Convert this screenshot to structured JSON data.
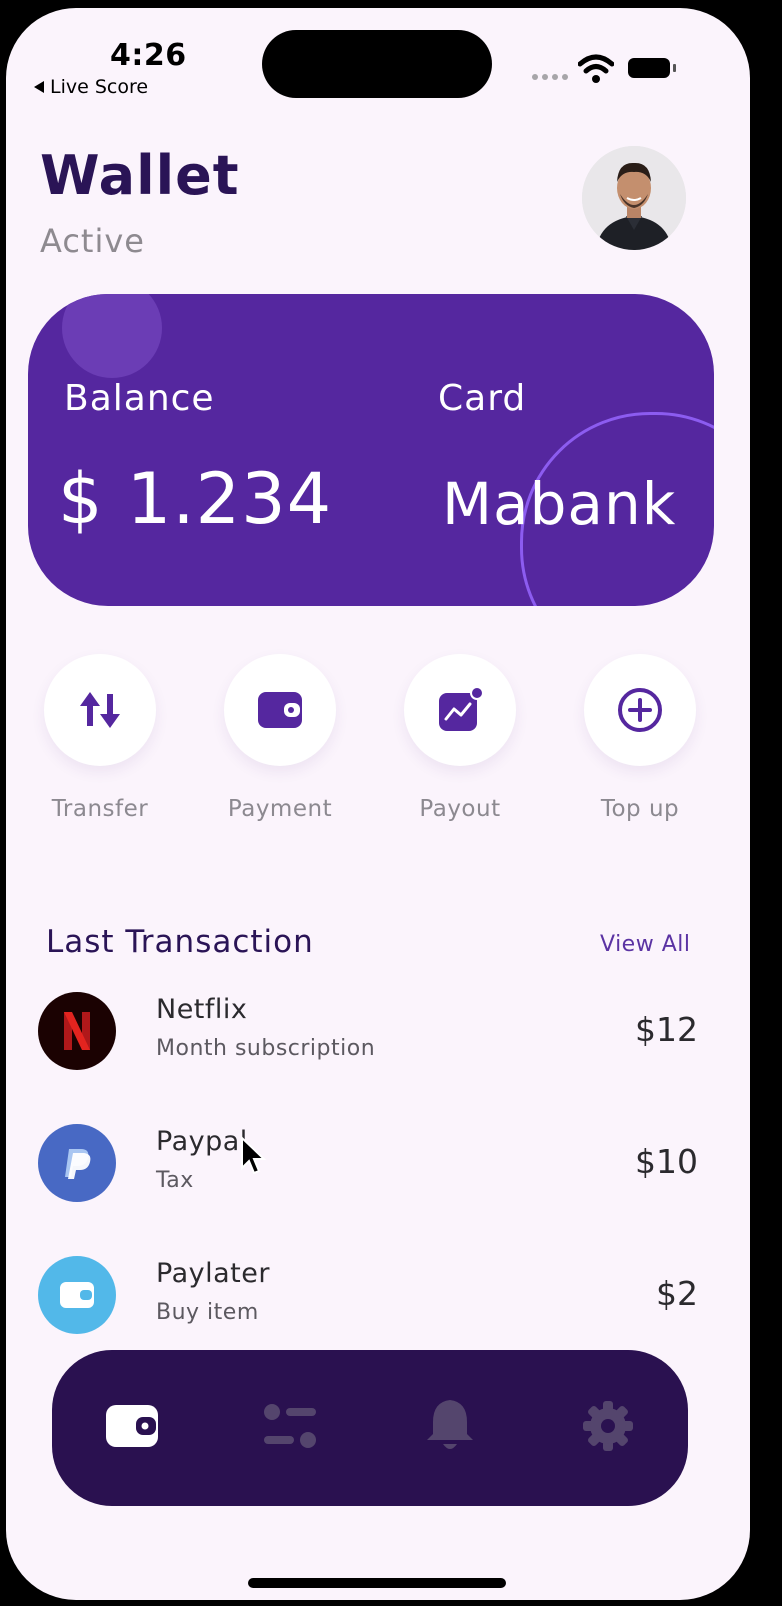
{
  "status_bar": {
    "time": "4:26",
    "back_label": "Live Score"
  },
  "header": {
    "title": "Wallet",
    "subtitle": "Active"
  },
  "card": {
    "balance_label": "Balance",
    "balance_value": "$ 1.234",
    "card_label": "Card",
    "card_value": "Mabank"
  },
  "actions": [
    {
      "label": "Transfer",
      "icon": "transfer-arrows-icon"
    },
    {
      "label": "Payment",
      "icon": "wallet-icon"
    },
    {
      "label": "Payout",
      "icon": "chart-icon"
    },
    {
      "label": "Top up",
      "icon": "plus-circle-icon"
    }
  ],
  "transactions": {
    "title": "Last Transaction",
    "view_all": "View All",
    "items": [
      {
        "name": "Netflix",
        "desc": "Month subscription",
        "amount": "$12",
        "icon": "netflix-logo"
      },
      {
        "name": "Paypal",
        "desc": "Tax",
        "amount": "$10",
        "icon": "paypal-logo"
      },
      {
        "name": "Paylater",
        "desc": "Buy item",
        "amount": "$2",
        "icon": "wallet-icon"
      }
    ]
  },
  "nav": [
    "wallet-icon",
    "sliders-icon",
    "bell-icon",
    "gear-icon"
  ],
  "colors": {
    "primary": "#55279F",
    "nav_background": "#2A1150",
    "background": "#FBF4FC",
    "title": "#2A1456",
    "netflix_red": "#D2201E",
    "paypal_blue": "#4869C4",
    "paylater_blue": "#52B8E9"
  }
}
